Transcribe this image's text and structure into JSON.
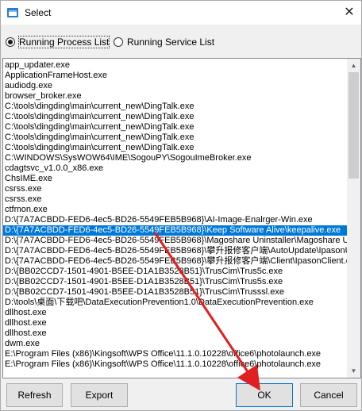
{
  "window": {
    "title": "Select",
    "close_glyph": "✕"
  },
  "radios": [
    {
      "label": "Running Process List",
      "checked": true
    },
    {
      "label": "Running Service List",
      "checked": false
    }
  ],
  "list": {
    "items": [
      "app_updater.exe",
      "ApplicationFrameHost.exe",
      "audiodg.exe",
      "browser_broker.exe",
      "C:\\tools\\dingding\\main\\current_new\\DingTalk.exe",
      "C:\\tools\\dingding\\main\\current_new\\DingTalk.exe",
      "C:\\tools\\dingding\\main\\current_new\\DingTalk.exe",
      "C:\\tools\\dingding\\main\\current_new\\DingTalk.exe",
      "C:\\tools\\dingding\\main\\current_new\\DingTalk.exe",
      "C:\\WINDOWS\\SysWOW64\\IME\\SogouPY\\SogouImeBroker.exe",
      "cdagtsvc_v1.0.0_x86.exe",
      "ChsIME.exe",
      "csrss.exe",
      "csrss.exe",
      "ctfmon.exe",
      "D:\\{7A7ACBDD-FED6-4ec5-BD26-5549FEB5B968}\\AI-Image-Enalrger-Win.exe",
      "D:\\{7A7ACBDD-FED6-4ec5-BD26-5549FEB5B968}\\Keep Software Alive\\keepalive.exe",
      "D:\\{7A7ACBDD-FED6-4ec5-BD26-5549FEB5B968}\\Magoshare Uninstaller\\Magoshare Unins",
      "D:\\{7A7ACBDD-FED6-4ec5-BD26-5549FEB5B968}\\攀升报修客户端\\AutoUpdate\\IpasonU",
      "D:\\{7A7ACBDD-FED6-4ec5-BD26-5549FEB5B968}\\攀升报修客户端\\Client\\IpasonClient.e",
      "D:\\{BB02CCD7-1501-4901-B5EE-D1A1B3528B51}\\TrusCim\\Trus5c.exe",
      "D:\\{BB02CCD7-1501-4901-B5EE-D1A1B3528B51}\\TrusCim\\Trus5s.exe",
      "D:\\{BB02CCD7-1501-4901-B5EE-D1A1B3528B51}\\TrusCim\\Trusssl.exe",
      "D:\\tools\\桌面\\下载吧\\DataExecutionPrevention1.0\\DataExecutionPrevention.exe",
      "dllhost.exe",
      "dllhost.exe",
      "dllhost.exe",
      "dwm.exe",
      "E:\\Program Files (x86)\\Kingsoft\\WPS Office\\11.1.0.10228\\office6\\photolaunch.exe",
      "E:\\Program Files (x86)\\Kingsoft\\WPS Office\\11.1.0.10228\\office6\\photolaunch.exe"
    ],
    "selected_index": 16
  },
  "buttons": {
    "refresh": "Refresh",
    "export": "Export",
    "ok": "OK",
    "cancel": "Cancel"
  },
  "colors": {
    "selection": "#0078d7",
    "annotation_arrow": "#e02020"
  },
  "icons": {
    "app": "app-icon",
    "scroll_up": "scroll-up-arrow-icon",
    "scroll_down": "scroll-down-arrow-icon"
  }
}
